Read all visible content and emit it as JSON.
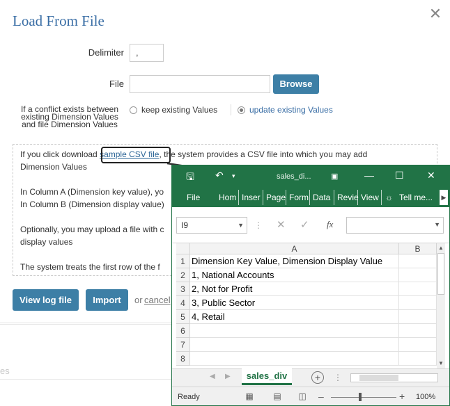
{
  "background": {
    "partial_text": "es"
  },
  "dialog": {
    "title": "Load From File",
    "close_symbol": "✕",
    "delimiter_label": "Delimiter",
    "delimiter_value": ",",
    "file_label": "File",
    "browse_label": "Browse",
    "conflict_label_lines": [
      "If a conflict exists between",
      "existing Dimension Values",
      "and file Dimension Values"
    ],
    "conflict_options": [
      {
        "label": "keep existing Values",
        "selected": false
      },
      {
        "label": "update existing Values",
        "selected": true
      }
    ],
    "info": {
      "line1_prefix": "If you click download ",
      "line1_link": "sample CSV file",
      "line1_suffix": ", the system provides a CSV file into which you may add",
      "line2": "Dimension Values",
      "line3": "In Column A (Dimension key value), yo",
      "line4": "In Column B (Dimension display value)",
      "line5": "Optionally, you may upload a file with c",
      "line6": "display values",
      "line7": "The system treats the first row of the f"
    },
    "view_log_label": "View log file",
    "import_label": "Import",
    "or_text": "or",
    "cancel_label": "cancel"
  },
  "excel": {
    "accent_color": "#217346",
    "title": "sales_di...",
    "ribbon_tabs": [
      "File",
      "Hom",
      "Inser",
      "Page",
      "Form",
      "Data",
      "Revie",
      "View"
    ],
    "tell_me": "Tell me...",
    "name_box": "I9",
    "columns": [
      "A",
      "B"
    ],
    "row_numbers": [
      "1",
      "2",
      "3",
      "4",
      "5",
      "6",
      "7",
      "8"
    ],
    "rows": [
      "Dimension Key Value, Dimension Display Value",
      "1, National Accounts",
      "2, Not for Profit",
      "3, Public Sector",
      "4, Retail",
      "",
      "",
      ""
    ],
    "sheet_tab": "sales_div",
    "status": "Ready",
    "zoom": "100%"
  }
}
